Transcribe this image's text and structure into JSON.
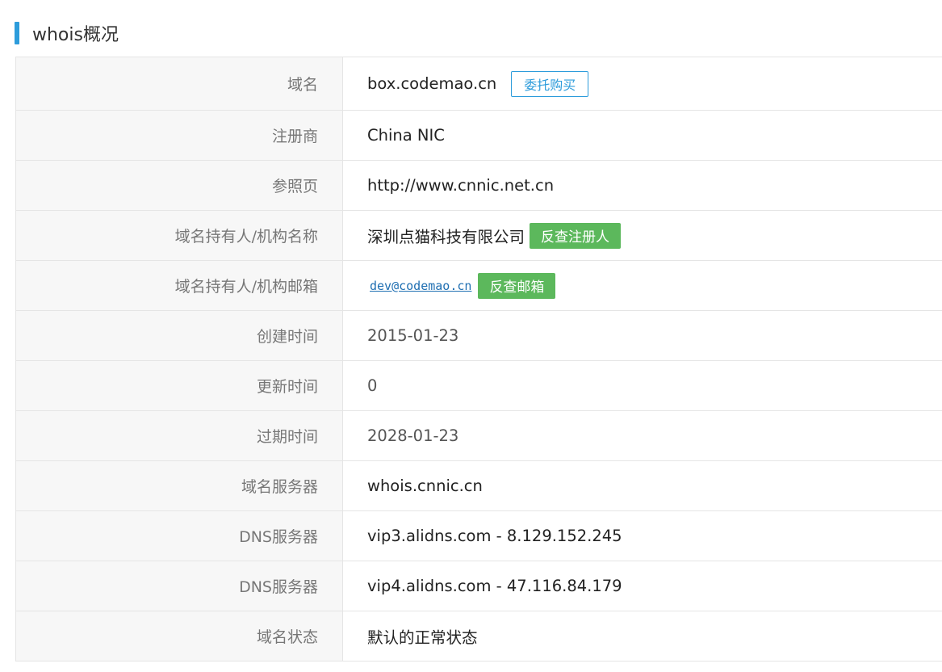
{
  "section": {
    "title": "whois概况"
  },
  "rows": [
    {
      "label": "域名",
      "value": "box.codemao.cn",
      "button": "委托购买"
    },
    {
      "label": "注册商",
      "value": "China NIC"
    },
    {
      "label": "参照页",
      "value": "http://www.cnnic.net.cn"
    },
    {
      "label": "域名持有人/机构名称",
      "value": "深圳点猫科技有限公司",
      "button": "反查注册人"
    },
    {
      "label": "域名持有人/机构邮箱",
      "value": "dev@codemao.cn",
      "button": "反查邮箱"
    },
    {
      "label": "创建时间",
      "value": "2015-01-23"
    },
    {
      "label": "更新时间",
      "value": "0"
    },
    {
      "label": "过期时间",
      "value": "2028-01-23"
    },
    {
      "label": "域名服务器",
      "value": "whois.cnnic.cn"
    },
    {
      "label": "DNS服务器",
      "value": "vip3.alidns.com - 8.129.152.245"
    },
    {
      "label": "DNS服务器",
      "value": "vip4.alidns.com - 47.116.84.179"
    },
    {
      "label": "域名状态",
      "value": "默认的正常状态"
    }
  ],
  "colors": {
    "accent": "#2d9cdb",
    "green_button": "#5cb85c",
    "link": "#1f6fb2",
    "label_bg": "#f7f7f7",
    "border": "#e5e5e5"
  }
}
